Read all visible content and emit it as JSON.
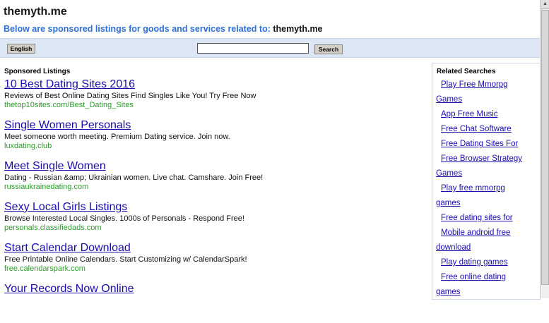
{
  "header": {
    "domain": "themyth.me",
    "subtitle_prefix": "Below are sponsored listings for goods and services related to:",
    "subtitle_domain": "themyth.me"
  },
  "toolbar": {
    "language_label": "English",
    "search_value": "",
    "search_label": "Search"
  },
  "listings": {
    "heading": "Sponsored Listings",
    "items": [
      {
        "title": "10 Best Dating Sites 2016",
        "desc": "Reviews of Best Online Dating Sites Find Singles Like You! Try Free Now",
        "url": "thetop10sites.com/Best_Dating_Sites"
      },
      {
        "title": "Single Women Personals",
        "desc": "Meet someone worth meeting. Premium Dating service. Join now.",
        "url": "luxdating.club"
      },
      {
        "title": "Meet Single Women",
        "desc": "Dating - Russian &amp; Ukrainian women. Live chat. Camshare. Join Free!",
        "url": "russiaukrainedating.com"
      },
      {
        "title": "Sexy Local Girls Listings",
        "desc": "Browse Interested Local Singles. 1000s of Personals - Respond Free!",
        "url": "personals.classifiedads.com"
      },
      {
        "title": "Start Calendar Download",
        "desc": "Free Printable Online Calendars. Start Customizing w/ CalendarSpark!",
        "url": "free.calendarspark.com"
      },
      {
        "title": "Your Records Now Online",
        "desc": "",
        "url": ""
      }
    ]
  },
  "related": {
    "heading": "Related Searches",
    "items": [
      {
        "line1": "Play Free Mmorpg",
        "line2": "Games"
      },
      {
        "line1": "App Free Music",
        "line2": ""
      },
      {
        "line1": "Free Chat Software",
        "line2": ""
      },
      {
        "line1": "Free Dating Sites For",
        "line2": ""
      },
      {
        "line1": "Free Browser Strategy",
        "line2": "Games"
      },
      {
        "line1": "Play free mmorpg",
        "line2": "games"
      },
      {
        "line1": "Free dating sites for",
        "line2": ""
      },
      {
        "line1": "Mobile android free",
        "line2": "download"
      },
      {
        "line1": "Play dating games",
        "line2": ""
      },
      {
        "line1": "Free online dating",
        "line2": "games"
      }
    ]
  },
  "colors": {
    "link": "#1a0dab",
    "url_green": "#2e9a2e",
    "subtitle_blue": "#2e6fd6",
    "bar_bg": "#dce6f4"
  }
}
